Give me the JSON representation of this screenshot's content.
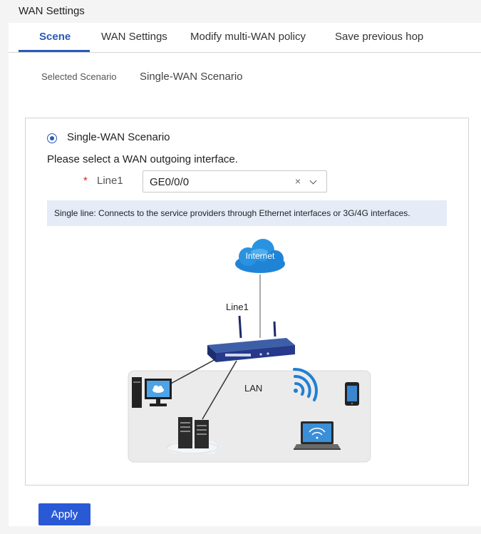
{
  "page": {
    "title": "WAN Settings"
  },
  "tabs": [
    {
      "label": "Scene",
      "active": true
    },
    {
      "label": "WAN Settings",
      "active": false
    },
    {
      "label": "Modify multi-WAN policy",
      "active": false
    },
    {
      "label": "Save previous hop",
      "active": false
    }
  ],
  "selected_scenario": {
    "label": "Selected Scenario",
    "value": "Single-WAN Scenario"
  },
  "scenario": {
    "radio_label": "Single-WAN Scenario",
    "prompt": "Please select a WAN outgoing interface.",
    "required_mark": "*",
    "line_label": "Line1",
    "line_value": "GE0/0/0",
    "clear_glyph": "×",
    "info": "Single line: Connects to the service providers through Ethernet interfaces or 3G/4G interfaces."
  },
  "diagram": {
    "cloud_label": "Internet",
    "link_label": "Line1",
    "lan_label": "LAN",
    "icons": [
      "cloud-icon",
      "router-icon",
      "desktop-icon",
      "server-icon",
      "wifi-icon",
      "phone-icon",
      "laptop-icon"
    ]
  },
  "actions": {
    "apply": "Apply"
  },
  "colors": {
    "accent": "#2a59b8",
    "button": "#2a59d6",
    "info_bg": "#e5ecf8",
    "required": "#e02020"
  }
}
